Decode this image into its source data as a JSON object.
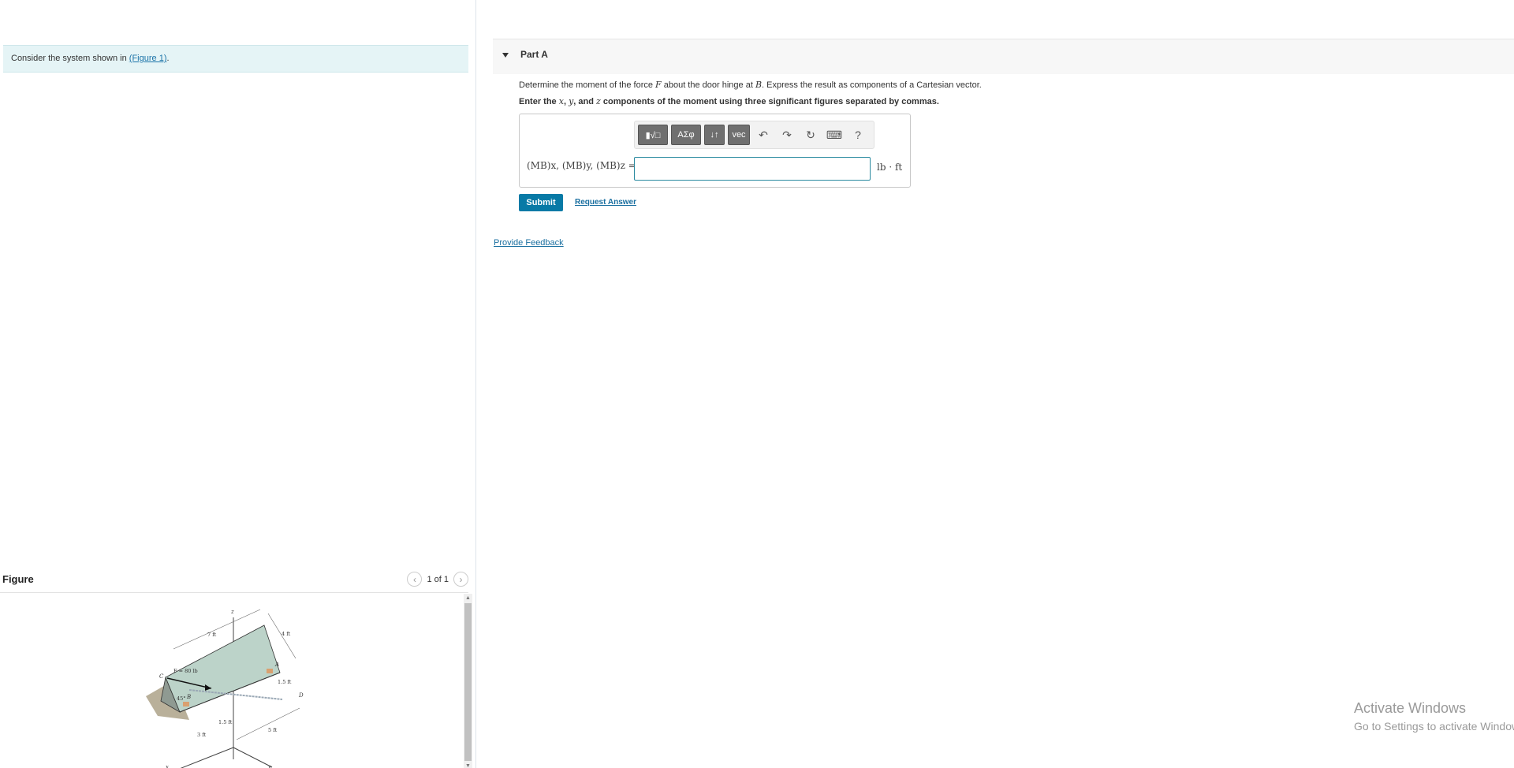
{
  "left": {
    "intro_prefix": "Consider the system shown in ",
    "intro_link": "(Figure 1)",
    "intro_suffix": ".",
    "figure_title": "Figure",
    "pager_text": "1 of 1",
    "figure_labels": {
      "z": "z",
      "x": "x",
      "y": "y",
      "seven_ft": "7 ft",
      "four_ft": "4 ft",
      "force": "F = 80 lb",
      "c": "C",
      "a": "A",
      "b": "B",
      "d": "D",
      "one_five_a": "1.5 ft",
      "one_five_b": "1.5 ft",
      "three_ft": "3 ft",
      "five_ft": "5 ft",
      "angle": "45°"
    }
  },
  "part": {
    "title": "Part A",
    "q1_a": "Determine the moment of the force ",
    "q1_f": "F",
    "q1_b": " about the door hinge at ",
    "q1_bvar": "B",
    "q1_c": ". Express the result as components of a Cartesian vector.",
    "q2_a": "Enter the ",
    "q2_x": "x",
    "q2_b": ", ",
    "q2_y": "y",
    "q2_c": ", and ",
    "q2_z": "z",
    "q2_d": " components of the moment using three significant figures separated by commas.",
    "toolbar": {
      "templates_label": "▮√□",
      "greek_label": "ΑΣφ",
      "arrows_label": "↓↑",
      "vec_label": "vec",
      "undo_icon": "↶",
      "redo_icon": "↷",
      "reset_icon": "↻",
      "keyboard_icon": "⌨",
      "help_label": "?"
    },
    "equation_label": "(MB)x, (MB)y, (MB)z =",
    "answer_value": "",
    "unit": "lb · ft",
    "submit_label": "Submit",
    "request_label": "Request Answer"
  },
  "feedback_label": "Provide Feedback",
  "watermark": {
    "line1": "Activate Windows",
    "line2": "Go to Settings to activate Windows."
  }
}
